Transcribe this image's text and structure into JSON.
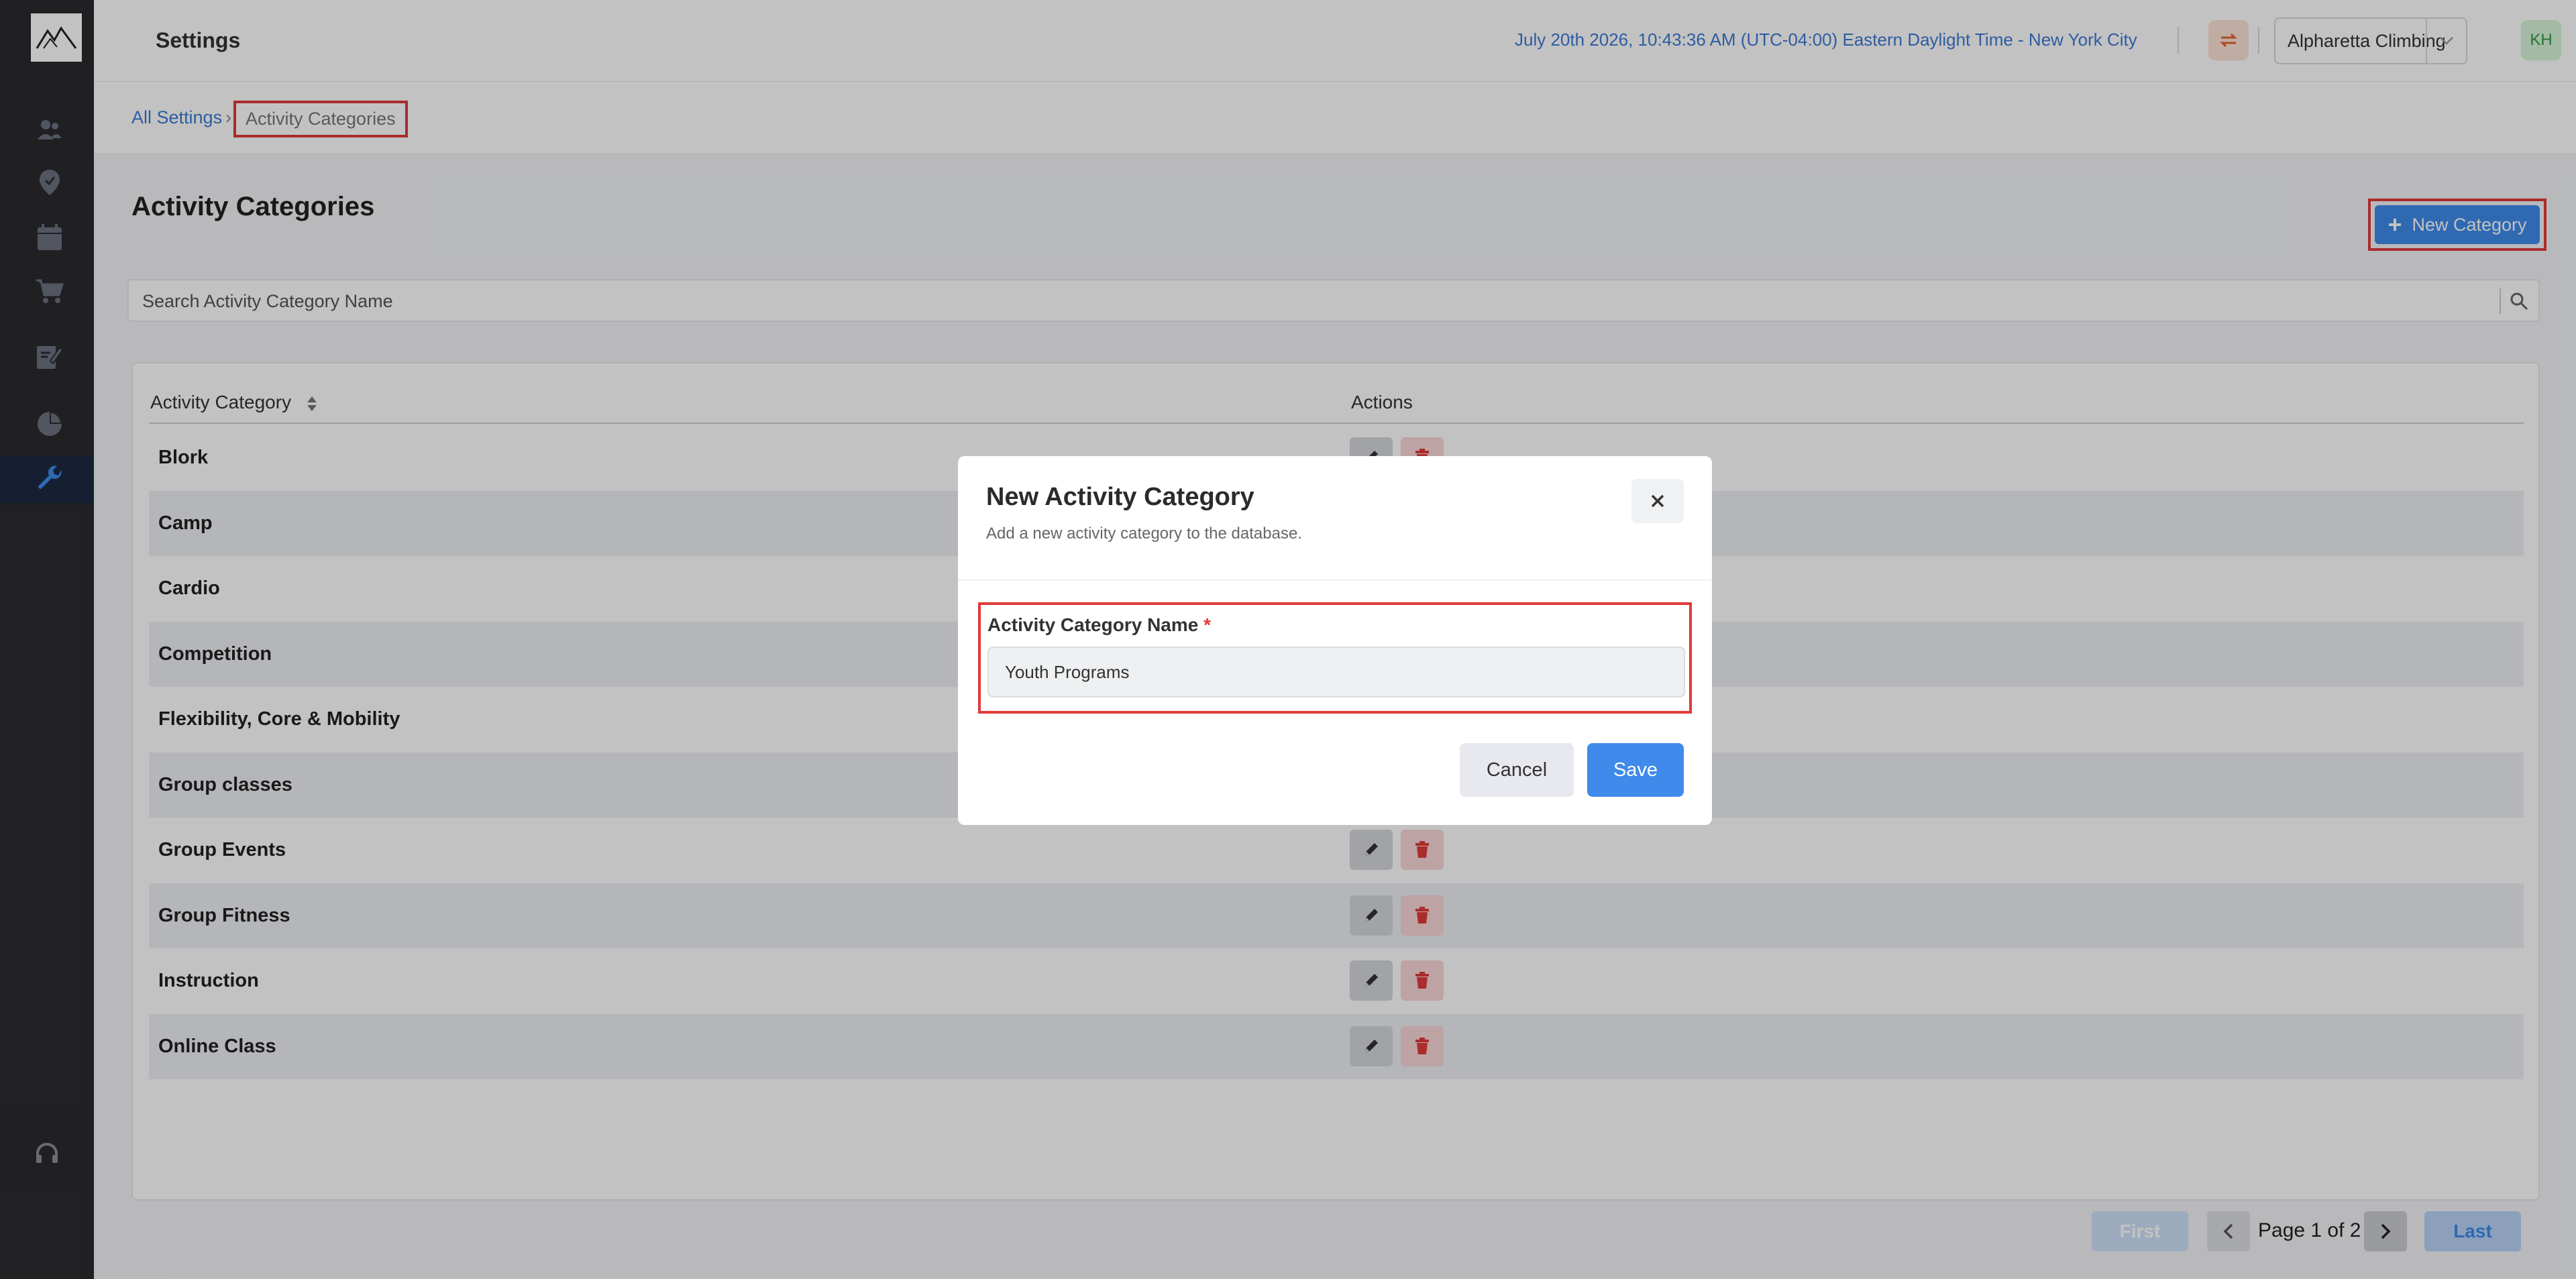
{
  "header": {
    "title": "Settings",
    "datetime": "July 20th 2026,  10:43:36 AM  (UTC-04:00) Eastern Daylight Time - New York City",
    "location": "Alpharetta Climbing",
    "avatar_initials": "KH"
  },
  "breadcrumb": {
    "root": "All Settings",
    "current": "Activity Categories"
  },
  "page": {
    "title": "Activity Categories",
    "new_button": "New Category",
    "search_placeholder": "Search Activity Category Name"
  },
  "table": {
    "col_category": "Activity Category",
    "col_actions": "Actions",
    "rows": [
      "Blork",
      "Camp",
      "Cardio",
      "Competition",
      "Flexibility, Core & Mobility",
      "Group classes",
      "Group Events",
      "Group Fitness",
      "Instruction",
      "Online Class"
    ]
  },
  "pagination": {
    "first": "First",
    "page_text": "Page 1 of 2",
    "last": "Last"
  },
  "modal": {
    "title": "New Activity Category",
    "subtitle": "Add a new activity category to the database.",
    "field_label": "Activity Category Name",
    "required_mark": "*",
    "field_value": "Youth Programs",
    "cancel": "Cancel",
    "save": "Save"
  },
  "colors": {
    "accent": "#3f8aea",
    "danger": "#e03a3a",
    "sidebar": "#2b2b2e"
  }
}
